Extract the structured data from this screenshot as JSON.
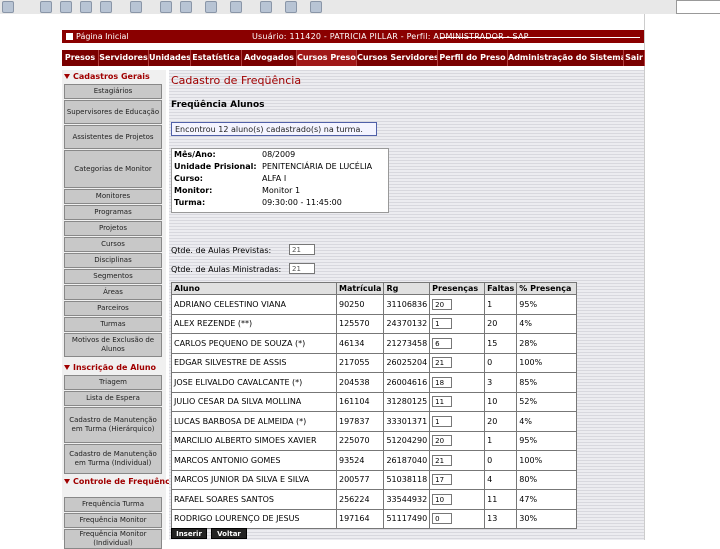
{
  "header": {
    "home_label": "Página Inicial",
    "user_line": "Usuário: 111420 - PATRICIA PILLAR - Perfil: ADMINISTRADOR - SAP"
  },
  "nav": {
    "items": [
      "Presos",
      "Servidores",
      "Unidades",
      "Estatística",
      "Advogados",
      "Cursos Presos",
      "Cursos Servidores",
      "Perfil do Preso",
      "Administração do Sistema",
      "Sair"
    ],
    "selected": "Cursos Presos"
  },
  "sidebar": {
    "sections": [
      {
        "title": "Cadastros Gerais",
        "items": [
          "Estagiários",
          "Supervisores de Educação",
          "Assistentes de Projetos",
          "Categorias de Monitor",
          "Monitores",
          "Programas",
          "Projetos",
          "Cursos",
          "Disciplinas",
          "Segmentos",
          "Áreas",
          "Parceiros",
          "Turmas",
          "Motivos de Exclusão de Alunos"
        ]
      },
      {
        "title": "Inscrição de Aluno",
        "items": [
          "Triagem",
          "Lista de Espera",
          "Cadastro de Manutenção em Turma (Hierárquico)",
          "Cadastro de Manutenção em Turma (Individual)"
        ]
      },
      {
        "title": "Controle de Frequência/Notas",
        "items": [
          "Frequência Turma",
          "Frequência Monitor",
          "Frequência Monitor (Individual)"
        ]
      }
    ]
  },
  "main": {
    "title": "Cadastro de Freqüência",
    "subtitle": "Freqüência Alunos",
    "message": "Encontrou 12 aluno(s) cadastrado(s) na turma.",
    "info": [
      {
        "label": "Mês/Ano:",
        "value": "08/2009"
      },
      {
        "label": "Unidade Prisional:",
        "value": "PENITENCIÁRIA DE LUCÉLIA"
      },
      {
        "label": "Curso:",
        "value": "ALFA I"
      },
      {
        "label": "Monitor:",
        "value": "Monitor 1"
      },
      {
        "label": "Turma:",
        "value": "09:30:00 - 11:45:00"
      }
    ],
    "aulas_previstas_label": "Qtde. de Aulas Previstas:",
    "aulas_previstas_value": "21",
    "aulas_ministradas_label": "Qtde. de Aulas Ministradas:",
    "aulas_ministradas_value": "21",
    "table": {
      "headers": [
        "Aluno",
        "Matrícula",
        "Rg",
        "Presenças",
        "Faltas",
        "% Presença"
      ],
      "rows": [
        [
          "ADRIANO CELESTINO VIANA",
          "90250",
          "31106836",
          "20",
          "1",
          "95%"
        ],
        [
          "ALEX REZENDE (**)",
          "125570",
          "24370132",
          "1",
          "20",
          "4%"
        ],
        [
          "CARLOS PEQUENO DE SOUZA (*)",
          "46134",
          "21273458",
          "6",
          "15",
          "28%"
        ],
        [
          "EDGAR SILVESTRE DE ASSIS",
          "217055",
          "26025204",
          "21",
          "0",
          "100%"
        ],
        [
          "JOSE ELIVALDO CAVALCANTE (*)",
          "204538",
          "26004616",
          "18",
          "3",
          "85%"
        ],
        [
          "JULIO CESAR DA SILVA MOLLINA",
          "161104",
          "31280125",
          "11",
          "10",
          "52%"
        ],
        [
          "LUCAS BARBOSA DE ALMEIDA (*)",
          "197837",
          "33301371",
          "1",
          "20",
          "4%"
        ],
        [
          "MARCILIO ALBERTO SIMOES XAVIER",
          "225070",
          "51204290",
          "20",
          "1",
          "95%"
        ],
        [
          "MARCOS ANTONIO GOMES",
          "93524",
          "26187040",
          "21",
          "0",
          "100%"
        ],
        [
          "MARCOS JUNIOR DA SILVA E SILVA",
          "200577",
          "51038118",
          "17",
          "4",
          "80%"
        ],
        [
          "RAFAEL SOARES SANTOS",
          "256224",
          "33544932",
          "10",
          "11",
          "47%"
        ],
        [
          "RODRIGO LOURENÇO DE JESUS",
          "197164",
          "51117490",
          "0",
          "13",
          "30%"
        ]
      ]
    },
    "buttons": {
      "insert": "Inserir",
      "back": "Voltar"
    }
  },
  "colors": {
    "header_bg": "#8a0000",
    "nav_bg": "#7a0000",
    "accent": "#a00000"
  }
}
